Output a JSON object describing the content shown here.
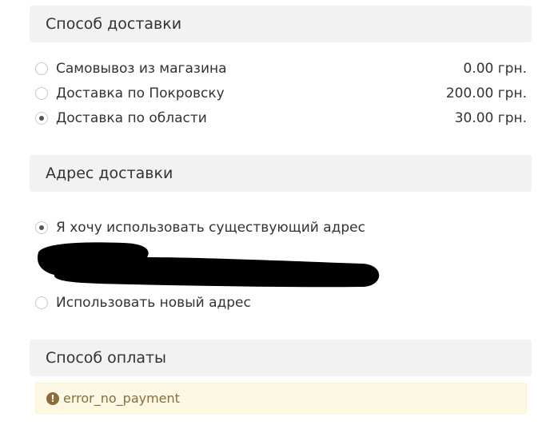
{
  "delivery": {
    "title": "Способ доставки",
    "options": [
      {
        "label": "Самовывоз из магазина",
        "price": "0.00 грн.",
        "selected": false
      },
      {
        "label": "Доставка по Покровску",
        "price": "200.00 грн.",
        "selected": false
      },
      {
        "label": "Доставка по области",
        "price": "30.00 грн.",
        "selected": true
      }
    ]
  },
  "address": {
    "title": "Адрес доставки",
    "existing_label": "Я хочу использовать существующий адрес",
    "existing_selected": true,
    "new_label": "Использовать новый адрес",
    "new_selected": false
  },
  "payment": {
    "title": "Способ оплаты",
    "alert_icon": "exclamation-circle-icon",
    "alert_text": "error_no_payment"
  },
  "colors": {
    "header_bg": "#f2f2f2",
    "alert_bg": "#fcf8e3",
    "alert_text": "#8a6d3b",
    "text": "#333333"
  }
}
